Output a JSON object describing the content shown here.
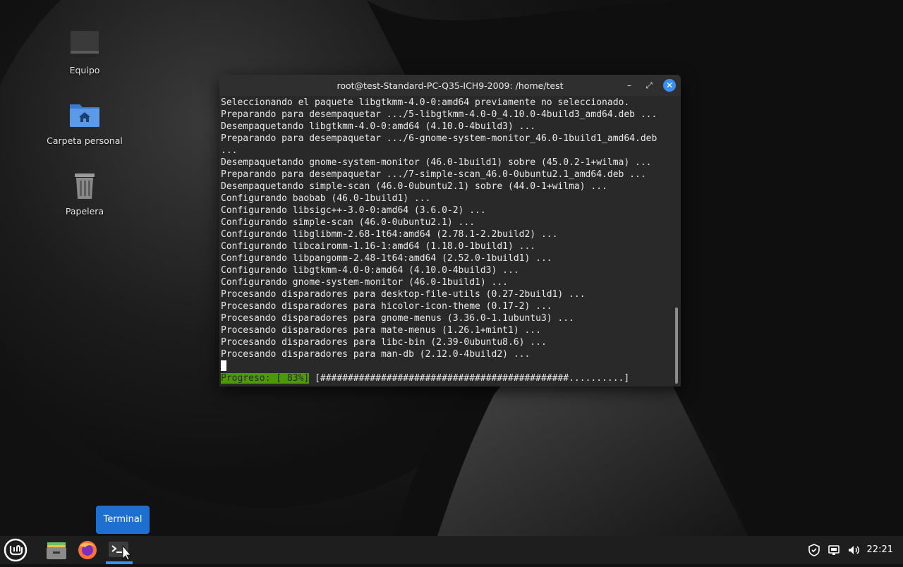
{
  "desktop": {
    "icons": [
      {
        "label": "Equipo",
        "icon": "computer-icon"
      },
      {
        "label": "Carpeta personal",
        "icon": "home-folder-icon"
      },
      {
        "label": "Papelera",
        "icon": "trash-icon"
      }
    ]
  },
  "terminal": {
    "title": "root@test-Standard-PC-Q35-ICH9-2009: /home/test",
    "lines": [
      "Seleccionando el paquete libgtkmm-4.0-0:amd64 previamente no seleccionado.",
      "Preparando para desempaquetar .../5-libgtkmm-4.0-0_4.10.0-4build3_amd64.deb ...",
      "Desempaquetando libgtkmm-4.0-0:amd64 (4.10.0-4build3) ...",
      "Preparando para desempaquetar .../6-gnome-system-monitor_46.0-1build1_amd64.deb",
      "...",
      "Desempaquetando gnome-system-monitor (46.0-1build1) sobre (45.0.2-1+wilma) ...",
      "Preparando para desempaquetar .../7-simple-scan_46.0-0ubuntu2.1_amd64.deb ...",
      "Desempaquetando simple-scan (46.0-0ubuntu2.1) sobre (44.0-1+wilma) ...",
      "Configurando baobab (46.0-1build1) ...",
      "Configurando libsigc++-3.0-0:amd64 (3.6.0-2) ...",
      "Configurando simple-scan (46.0-0ubuntu2.1) ...",
      "Configurando libglibmm-2.68-1t64:amd64 (2.78.1-2.2build2) ...",
      "Configurando libcairomm-1.16-1:amd64 (1.18.0-1build1) ...",
      "Configurando libpangomm-2.48-1t64:amd64 (2.52.0-1build1) ...",
      "Configurando libgtkmm-4.0-0:amd64 (4.10.0-4build3) ...",
      "Configurando gnome-system-monitor (46.0-1build1) ...",
      "Procesando disparadores para desktop-file-utils (0.27-2build1) ...",
      "Procesando disparadores para hicolor-icon-theme (0.17-2) ...",
      "Procesando disparadores para gnome-menus (3.36.0-1.1ubuntu3) ...",
      "Procesando disparadores para mate-menus (1.26.1+mint1) ...",
      "Procesando disparadores para libc-bin (2.39-0ubuntu8.6) ...",
      "Procesando disparadores para man-db (2.12.0-4build2) ..."
    ],
    "progress_label": "Progreso: [ 83%]",
    "progress_bar": " [#############################################..........]",
    "progress_value": 0.83,
    "buttons": {
      "minimize": "–",
      "maximize": "⤢",
      "close": "✕"
    }
  },
  "tooltip": {
    "text": "Terminal"
  },
  "panel": {
    "launchers": [
      "menu-icon",
      "file-manager-icon",
      "firefox-icon",
      "terminal-icon"
    ],
    "tray": [
      "shield-icon",
      "network-icon",
      "volume-icon"
    ],
    "clock": "22:21"
  },
  "colors": {
    "accent": "#3b8ff0",
    "progress_bg": "#4e9a06",
    "panel": "#1e1e1e"
  }
}
